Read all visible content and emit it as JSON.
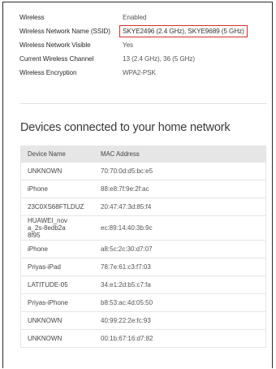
{
  "wireless_settings": [
    {
      "label": "Wireless",
      "value": "Enabled",
      "highlighted": false
    },
    {
      "label": "Wireless Network Name (SSID)",
      "value": "SKYE2496 (2.4 GHz), SKYE9689 (5 GHz)",
      "highlighted": true
    },
    {
      "label": "Wireless Network Visible",
      "value": "Yes",
      "highlighted": false
    },
    {
      "label": "Current Wireless Channel",
      "value": "13 (2.4 GHz), 36 (5 GHz)",
      "highlighted": false
    },
    {
      "label": "Wireless Encryption",
      "value": "WPA2-PSK",
      "highlighted": false
    }
  ],
  "devices": {
    "heading": "Devices connected to your home network",
    "columns": [
      "Device Name",
      "MAC Address"
    ],
    "rows": [
      {
        "name": "UNKNOWN",
        "mac": "70:70:0d:d5:bc:e5"
      },
      {
        "name": "iPhone",
        "mac": "88:e8:7f:9e:2f:ac"
      },
      {
        "name": "23C0XS68FTLDUZ",
        "mac": "20:47:47:3d:85:f4"
      },
      {
        "name": "HUAWEI_nova_2s-8edb2a8f95",
        "mac": "ec:89:14:40:3b:9c"
      },
      {
        "name": "iPhone",
        "mac": "a8:5c:2c:30:d7:07"
      },
      {
        "name": "Priyas-iPad",
        "mac": "78:7e:61:c3:f7:03"
      },
      {
        "name": "LATITUDE-05",
        "mac": "34:e1:2d:b5:c7:fa"
      },
      {
        "name": "Priyas-iPhone",
        "mac": "b8:53:ac:4d:05:50"
      },
      {
        "name": "UNKNOWN",
        "mac": "40:99:22:2e:fc:93"
      },
      {
        "name": "UNKNOWN",
        "mac": "00:1b:67:16:d7:82"
      }
    ]
  },
  "colors": {
    "highlight_border": "#d0312d",
    "table_header_bg": "#e6e6e6"
  }
}
